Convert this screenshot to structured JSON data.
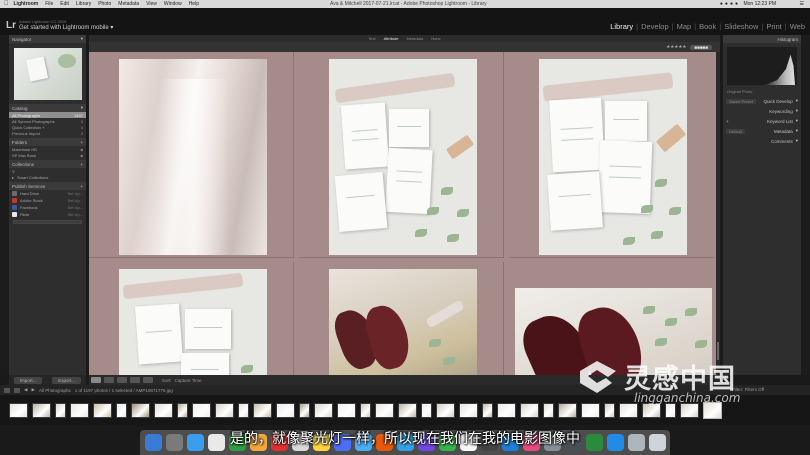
{
  "menubar": {
    "app": "Lightroom",
    "items": [
      "File",
      "Edit",
      "Library",
      "Photo",
      "Metadata",
      "View",
      "Window",
      "Help"
    ],
    "window_title": "Ava & Mitchell 2017-07-21.lrcat - Adobe Photoshop Lightroom - Library",
    "clock": "Mon 12:23 PM"
  },
  "identity": {
    "logo": "Lr",
    "small": "Adobe Lightroom CC 2015",
    "main": "Get started with Lightroom mobile"
  },
  "modules": [
    "Library",
    "Develop",
    "Map",
    "Book",
    "Slideshow",
    "Print",
    "Web"
  ],
  "active_module": "Library",
  "left_panel": {
    "navigator": "Navigator",
    "catalog": "Catalog",
    "catalog_items": [
      {
        "label": "All Photographs",
        "count": "1197"
      },
      {
        "label": "All Synced Photographs",
        "count": "0"
      },
      {
        "label": "Quick Collection +",
        "count": "0"
      },
      {
        "label": "Previous Import",
        "count": "0"
      }
    ],
    "folders": "Folders",
    "folder_items": [
      {
        "label": "Macintosh HD",
        "count": ""
      },
      {
        "label": "SP Mac Book",
        "count": ""
      }
    ],
    "collections": "Collections",
    "collection_items": [
      {
        "label": "Smart Collections",
        "count": ""
      }
    ],
    "publish": "Publish Services",
    "publish_items": [
      {
        "label": "Hard Drive",
        "color": "#6b6b6b"
      },
      {
        "label": "Adobe Stock",
        "color": "#c0392b"
      },
      {
        "label": "Facebook",
        "color": "#3b5998"
      },
      {
        "label": "Flickr",
        "color": "#e8e8e8"
      }
    ],
    "publish_setup": "Set Up...",
    "import_label": "Import...",
    "export_label": "Export..."
  },
  "center": {
    "filter_tabs": [
      "Text",
      "Attribute",
      "Metadata",
      "None"
    ],
    "active_filter": "Attribute",
    "sort_label": "Sort:",
    "sort_value": "Capture Time",
    "toolbar_label": "Capture Time"
  },
  "right_panel": {
    "histogram": "Histogram",
    "hist_info": "Original Photo",
    "rows": [
      {
        "label": "Quick Develop",
        "dd": "Saved Preset"
      },
      {
        "label": "Keywording",
        "dd": ""
      },
      {
        "label": "Keyword List",
        "dd": ""
      },
      {
        "label": "Metadata",
        "dd": "Default"
      },
      {
        "label": "Comments",
        "dd": ""
      }
    ]
  },
  "filmstrip": {
    "header": "All Photographs",
    "info": "1 of 1197 photos / 1 selected / AMP10871776.jpg",
    "filter_label": "Filter:",
    "filter_value": "Filters Off",
    "thumb_colors": [
      "#e6e2dc",
      "#b9b0a2",
      "#d8d3cb",
      "#e9e7e2",
      "#cbbfa7",
      "#eceae6",
      "#9d8f78",
      "#e2ddd6",
      "#b9ab96",
      "#f1efec",
      "#d9d2c6",
      "#e4e0d8",
      "#c8bca9",
      "#edebe7",
      "#a99f8d",
      "#dcd6cd",
      "#f0eeeb",
      "#d0c5b3",
      "#e8e4de",
      "#bdb3a2",
      "#eeece8",
      "#d5cec2",
      "#e7e3dc",
      "#c4b8a4",
      "#ecebe7",
      "#dad4ca",
      "#e3ded6",
      "#b7ab99",
      "#efede9",
      "#d2c9ba",
      "#e6e2db",
      "#cabfae",
      "#ebe9e4",
      "#d6d0c5",
      "#e1dcd4"
    ]
  },
  "dock_colors": [
    "#3a7bd5",
    "#7a7a7a",
    "#3b9ded",
    "#e9e9e9",
    "#2f9e44",
    "#f2a93b",
    "#e03131",
    "#d9d9d9",
    "#ffd43b",
    "#4c6ef5",
    "#4dabf7",
    "#e8590c",
    "#31a1e0",
    "#7048e8",
    "#37b24d",
    "#f8f9fa",
    "#444",
    "#1c7ed6",
    "#e64980",
    "#868e96",
    "#495057",
    "#2b8a3e",
    "#228be6",
    "#adb5bd",
    "#ced4da"
  ],
  "subtitle": "是的，就像聚光灯一样，所以现在我们在我的电影图像中",
  "watermark": {
    "main": "灵感中国",
    "sub": "lingganchina.com"
  }
}
